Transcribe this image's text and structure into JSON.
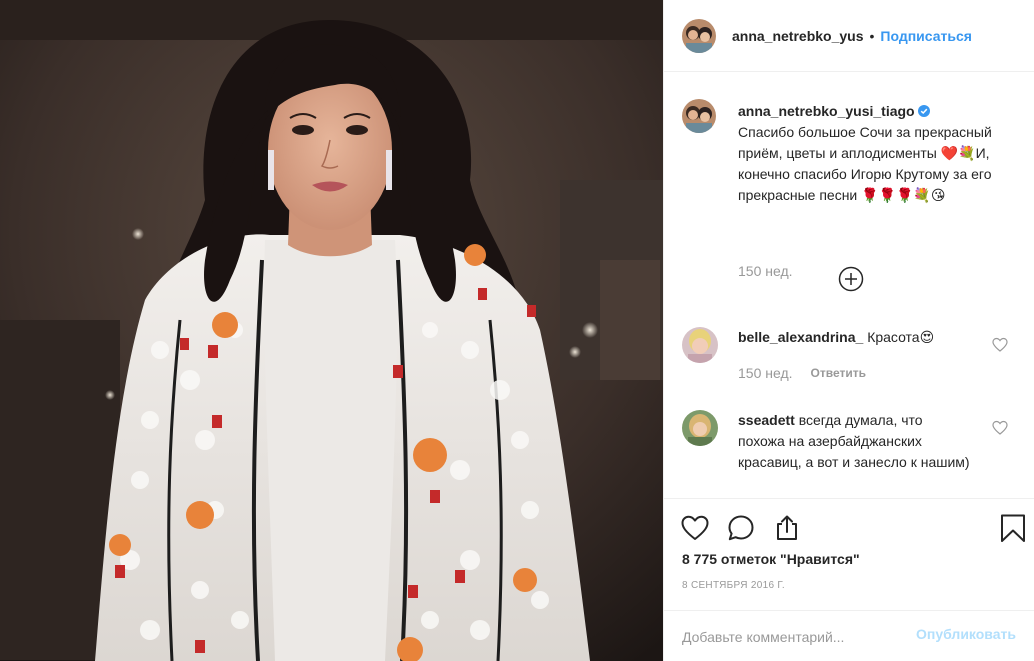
{
  "header": {
    "username": "anna_netrebko_yus",
    "separator": "•",
    "follow_label": "Подписаться",
    "avatar_icon": "avatar-icon"
  },
  "caption": {
    "username": "anna_netrebko_yusi_tiago",
    "verified_icon": "verified-badge-icon",
    "text": "Спасибо большое Сочи за прекрасный приём, цветы и аплодисменты ❤️💐И, конечно спасибо Игорю Крутому за его прекрасные песни 🌹🌹🌹💐😘",
    "time": "150 нед."
  },
  "load_more_icon": "plus-circle-icon",
  "comments": [
    {
      "username": "belle_alexandrina_",
      "text": "Красота😍",
      "time": "150 нед.",
      "reply_label": "Ответить",
      "like_icon": "heart-outline-icon"
    },
    {
      "username": "sseadett",
      "text": "всегда думала, что похожа на азербайджанских красавиц, а вот и занесло к нашим)",
      "like_icon": "heart-outline-icon"
    }
  ],
  "actions": {
    "like_icon": "heart-icon",
    "comment_icon": "comment-icon",
    "share_icon": "share-icon",
    "save_icon": "bookmark-icon",
    "likes": "8 775 отметок \"Нравится\"",
    "date": "8 сентября 2016 г."
  },
  "add_comment": {
    "placeholder": "Добавьте комментарий...",
    "publish_label": "Опубликовать"
  },
  "colors": {
    "link_blue": "#3897f0",
    "publish_disabled": "#b2dffc",
    "muted": "#999999",
    "text": "#262626",
    "verified": "#3897f0"
  }
}
